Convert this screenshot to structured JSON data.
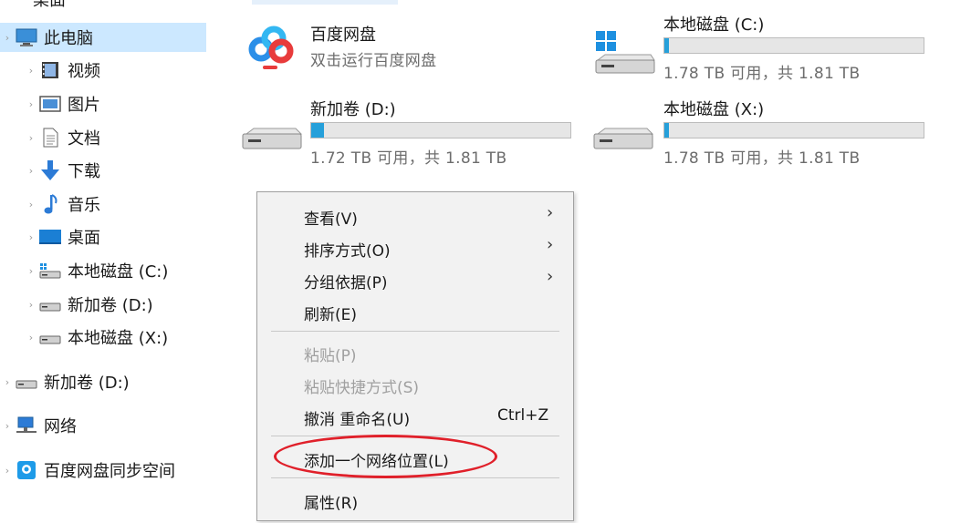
{
  "sidebar": {
    "top_partial": "桌面",
    "this_pc": "此电脑",
    "items": [
      {
        "label": "视频",
        "icon": "video-folder-icon"
      },
      {
        "label": "图片",
        "icon": "pictures-folder-icon"
      },
      {
        "label": "文档",
        "icon": "documents-folder-icon"
      },
      {
        "label": "下载",
        "icon": "download-arrow-icon"
      },
      {
        "label": "音乐",
        "icon": "music-note-icon"
      },
      {
        "label": "桌面",
        "icon": "desktop-folder-icon"
      },
      {
        "label": "本地磁盘 (C:)",
        "icon": "windows-drive-icon"
      },
      {
        "label": "新加卷 (D:)",
        "icon": "drive-icon"
      },
      {
        "label": "本地磁盘 (X:)",
        "icon": "drive-icon"
      }
    ],
    "removable": "新加卷 (D:)",
    "network": "网络",
    "baidu_sync": "百度网盘同步空间"
  },
  "main": {
    "baidu": {
      "name": "百度网盘",
      "sub": "双击运行百度网盘"
    },
    "drives": [
      {
        "name": "本地磁盘 (C:)",
        "free": "1.78 TB 可用，共 1.81 TB",
        "usage": 0.017
      },
      {
        "name": "新加卷 (D:)",
        "free": "1.72 TB 可用，共 1.81 TB",
        "usage": 0.05
      },
      {
        "name": "本地磁盘 (X:)",
        "free": "1.78 TB 可用，共 1.81 TB",
        "usage": 0.017
      }
    ]
  },
  "context_menu": {
    "view": "查看(V)",
    "sort": "排序方式(O)",
    "group": "分组依据(P)",
    "refresh": "刷新(E)",
    "paste": "粘贴(P)",
    "paste_shortcut": "粘贴快捷方式(S)",
    "undo": "撤消 重命名(U)",
    "undo_shortcut": "Ctrl+Z",
    "add_network": "添加一个网络位置(L)",
    "properties": "属性(R)",
    "submenu_arrow": "›"
  },
  "colors": {
    "selection": "#cce8ff",
    "drive_bar": "#26a0da",
    "annotation": "#e0202a"
  }
}
